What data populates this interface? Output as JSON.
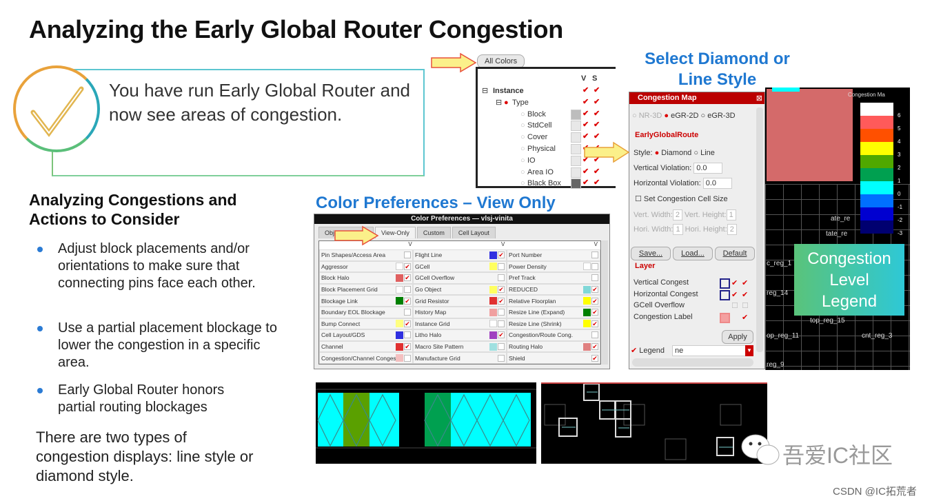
{
  "slide": {
    "title": "Analyzing the Early Global Router Congestion",
    "callout": "You have run Early Global Router and now see areas of congestion.",
    "actions_heading": "Analyzing Congestions and Actions to Consider",
    "bullets": [
      "Adjust block placements and/or orientations to make sure that connecting pins face each other.",
      "Use a partial placement blockage to lower the congestion in a specific area.",
      "Early Global Router honors partial routing blockages"
    ],
    "types_text": "There are two types of congestion displays: line style or diamond style.",
    "color_prefs_heading": "Color Preferences – View Only",
    "select_heading_1": "Select Diamond or",
    "select_heading_2": "Line Style",
    "legend_callout": [
      "Congestion",
      "Level",
      "Legend"
    ]
  },
  "color_prefs": {
    "window_title": "Color Preferences — vlsj-vinita",
    "tabs": [
      "Objec",
      "View-Only",
      "Custom",
      "Cell Layout"
    ],
    "selected_tab": "View-Only",
    "column_header": "V",
    "columns": [
      [
        {
          "label": "Pin Shapes/Access Area",
          "color": "",
          "checked": false
        },
        {
          "label": "Aggressor",
          "color": "#ffffff",
          "checked": true
        },
        {
          "label": "Block Halo",
          "color": "#e06060",
          "checked": true
        },
        {
          "label": "Block Placement Grid",
          "color": "#ffffff",
          "checked": false
        },
        {
          "label": "Blockage Link",
          "color": "#008000",
          "checked": true
        },
        {
          "label": "Boundary EOL Blockage",
          "color": "",
          "checked": false
        },
        {
          "label": "Bump Connect",
          "color": "#ffff80",
          "checked": true
        },
        {
          "label": "Cell Layout/GDS",
          "color": "#3030e0",
          "checked": false
        },
        {
          "label": "Channel",
          "color": "#e03030",
          "checked": true
        },
        {
          "label": "Congestion/Channel Congestion",
          "color": "#f4c0c0",
          "checked": false
        }
      ],
      [
        {
          "label": "Flight Line",
          "color": "#3030e0",
          "checked": true
        },
        {
          "label": "GCell",
          "color": "#ffff60",
          "checked": false
        },
        {
          "label": "GCell Overflow",
          "color": "",
          "checked": false
        },
        {
          "label": "Go Object",
          "color": "#ffff60",
          "checked": true
        },
        {
          "label": "Grid Resistor",
          "color": "#e03030",
          "checked": true
        },
        {
          "label": "History Map",
          "color": "#f0a0a0",
          "checked": false
        },
        {
          "label": "Instance Grid",
          "color": "#ffffff",
          "checked": false
        },
        {
          "label": "Litho Halo",
          "color": "#a040c0",
          "checked": true
        },
        {
          "label": "Macro Site Pattern",
          "color": "#a0e0e0",
          "checked": false
        },
        {
          "label": "Manufacture Grid",
          "color": "",
          "checked": false
        }
      ],
      [
        {
          "label": "Port Number",
          "color": "",
          "checked": false
        },
        {
          "label": "Power Density",
          "color": "#ffffff",
          "checked": false
        },
        {
          "label": "Pref Track",
          "color": "",
          "checked": false
        },
        {
          "label": "REDUCED",
          "color": "#80d8d8",
          "checked": true
        },
        {
          "label": "Relative Floorplan",
          "color": "#ffff00",
          "checked": true
        },
        {
          "label": "Resize Line (Expand)",
          "color": "#008000",
          "checked": true
        },
        {
          "label": "Resize Line (Shrink)",
          "color": "#ffff00",
          "checked": true
        },
        {
          "label": "Congestion/Route Cong.",
          "color": "",
          "checked": false
        },
        {
          "label": "Routing Halo",
          "color": "#e08080",
          "checked": true
        },
        {
          "label": "Shield",
          "color": "",
          "checked": true
        }
      ]
    ]
  },
  "all_colors": {
    "button": "All Colors",
    "col_v": "V",
    "col_s": "S",
    "tree": [
      {
        "label": "Instance",
        "level": 0
      },
      {
        "label": "Type",
        "level": 1
      },
      {
        "label": "Block",
        "level": 2,
        "color": "#bdbdbd"
      },
      {
        "label": "StdCell",
        "level": 2,
        "color": "#e8e8e8"
      },
      {
        "label": "Cover",
        "level": 2,
        "color": "#e8e8e8"
      },
      {
        "label": "Physical",
        "level": 2,
        "color": "#e8e8e8"
      },
      {
        "label": "IO",
        "level": 2,
        "color": "#e8e8e8"
      },
      {
        "label": "Area IO",
        "level": 2,
        "color": "#e8e8e8"
      },
      {
        "label": "Black Box",
        "level": 2,
        "color": "#666666"
      }
    ]
  },
  "congestion_map": {
    "title": "Congestion Map",
    "modes": [
      "NR-3D",
      "eGR-2D",
      "eGR-3D"
    ],
    "selected_mode": "eGR-2D",
    "section": "EarlyGlobalRoute",
    "style_label": "Style:",
    "styles": [
      "Diamond",
      "Line"
    ],
    "selected_style": "Diamond",
    "vertical_violation_label": "Vertical Violation:",
    "vertical_violation": "0.0",
    "horizontal_violation_label": "Horizontal Violation:",
    "horizontal_violation": "0.0",
    "set_cell_size": "Set Congestion Cell Size",
    "vert_width_label": "Vert. Width:",
    "vert_width": "2",
    "vert_height_label": "Vert. Height:",
    "vert_height": "1",
    "hori_width_label": "Hori. Width:",
    "hori_width": "1",
    "hori_height_label": "Hori. Height:",
    "hori_height": "2",
    "buttons": [
      "Save...",
      "Load...",
      "Default"
    ],
    "layer_section": "Layer",
    "layers": [
      "Vertical Congest",
      "Horizontal Congest",
      "GCell Overflow",
      "Congestion Label"
    ],
    "apply": "Apply",
    "legend_label": "Legend",
    "legend_value": "ne"
  },
  "map": {
    "legend_title": "Congestion Ma",
    "legend": [
      {
        "value": "6",
        "color": "#ffffff"
      },
      {
        "value": "5",
        "color": "#ff5a5a"
      },
      {
        "value": "4",
        "color": "#ff5000"
      },
      {
        "value": "3",
        "color": "#ffff00"
      },
      {
        "value": "2",
        "color": "#50a800"
      },
      {
        "value": "1",
        "color": "#00a050"
      },
      {
        "value": "0",
        "color": "#00ffff"
      },
      {
        "value": "-1",
        "color": "#0070ff"
      },
      {
        "value": "-2",
        "color": "#0000d0"
      },
      {
        "value": "-3",
        "color": "#000070"
      }
    ],
    "cell_names": [
      "ate_re",
      "tate_re",
      "c_reg_1",
      "reg_14",
      "top_reg_15",
      "op_reg_11",
      "cnt_reg_3",
      "reg_9"
    ]
  },
  "watermark": {
    "logo_text": "吾爱IC社区",
    "credit": "CSDN @IC拓荒者"
  },
  "colors": {
    "heading_blue": "#1f78d1",
    "arrow_yellow": "#fbf08a",
    "arrow_border": "#e8503a"
  }
}
